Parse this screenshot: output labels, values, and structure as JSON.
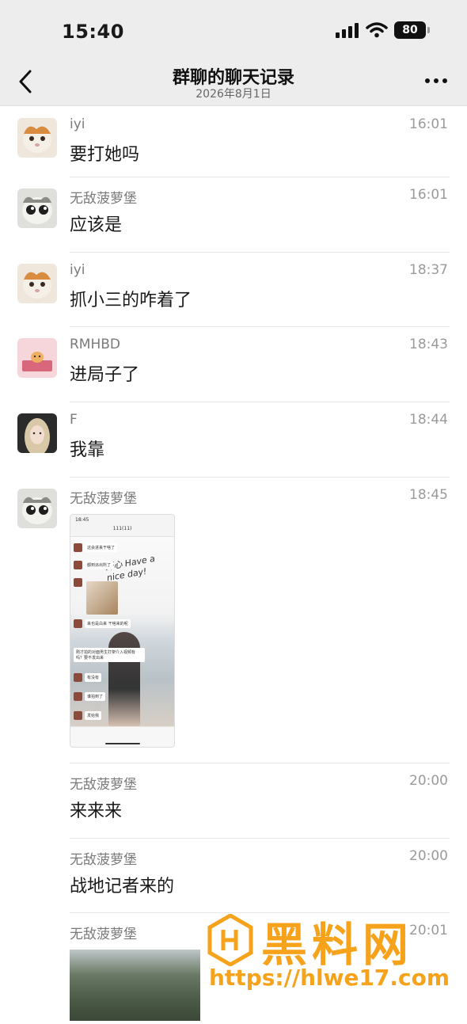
{
  "status_bar": {
    "time": "15:40",
    "battery": "80"
  },
  "nav": {
    "title": "群聊的聊天记录",
    "subtitle": "2026年8月1日"
  },
  "messages": [
    {
      "sender": "iyi",
      "time": "16:01",
      "text": "要打她吗"
    },
    {
      "sender": "无敌菠萝堡",
      "time": "16:01",
      "text": "应该是"
    },
    {
      "sender": "iyi",
      "time": "18:37",
      "text": "抓小三的咋着了"
    },
    {
      "sender": "RMHBD",
      "time": "18:43",
      "text": "进局子了"
    },
    {
      "sender": "F",
      "time": "18:44",
      "text": "我靠"
    },
    {
      "sender": "无敌菠萝堡",
      "time": "18:45"
    },
    {
      "sender": "无敌菠萝堡",
      "time": "20:00",
      "text": "来来来"
    },
    {
      "sender": "无敌菠萝堡",
      "time": "20:00",
      "text": "战地记者来的"
    },
    {
      "sender": "无敌菠萝堡",
      "time": "20:01"
    }
  ],
  "screenshot_card": {
    "status_time": "18:45",
    "title": "111(11)",
    "bubbles": [
      "这会进来干啥了",
      "都到派出所了",
      "来也是白来 干啥来的呢",
      "刚才拍的对面男生打架介入视频有吗？要不发出来",
      "有没有",
      "谁拍到了",
      "发给我"
    ],
    "handwriting": "开心 Have a nice day!"
  },
  "watermark": {
    "title": "黑料网",
    "url": "https://hlwe17.com"
  }
}
